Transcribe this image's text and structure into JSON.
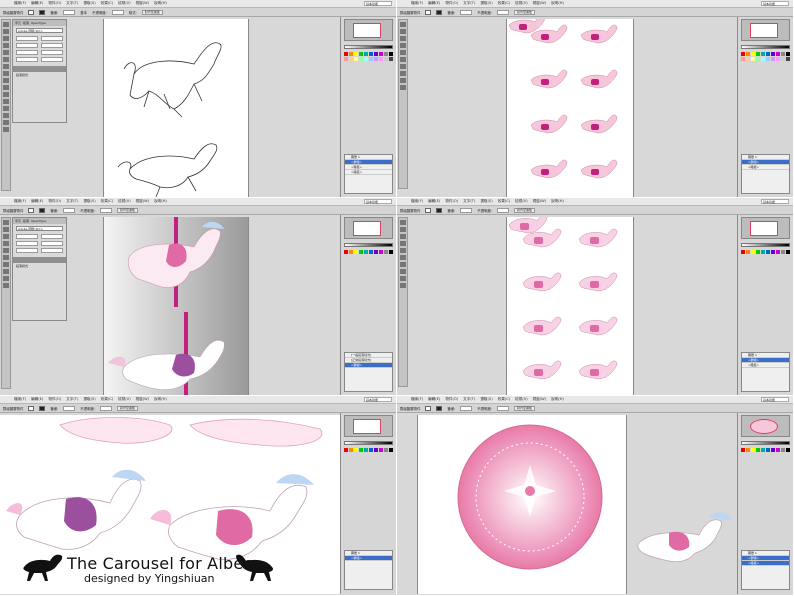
{
  "menu": {
    "items": [
      "檔案(F)",
      "編輯(E)",
      "物件(O)",
      "文字(T)",
      "選取(S)",
      "效果(C)",
      "檢視(V)",
      "視窗(W)",
      "說明(H)"
    ],
    "search_placeholder": "基本功能"
  },
  "control_bar": {
    "group_label": "群組圖層物件",
    "stroke_label": "筆畫:",
    "basic_label": "基本",
    "opacity_label": "不透明度:",
    "style_label": "樣式:",
    "align_label": "對齊至畫板"
  },
  "character_panel": {
    "tabs": [
      "字元",
      "段落",
      "OpenType"
    ],
    "font": "Adobe 明體 Std L",
    "paragraph_caption": "段落樣式",
    "paragraph_rows": [
      "[一般段落樣式]",
      "[正常段落樣式]"
    ]
  },
  "layers_panel": {
    "rows": [
      "圖層 1",
      "<群組>",
      "<路徑>",
      "<路徑>"
    ]
  },
  "colors": {
    "pink": "#e87aa8",
    "magenta": "#c2207c",
    "purple": "#9b4f9e",
    "selection": "#3a6ec8"
  },
  "caption": {
    "title": "The Carousel for Albee",
    "subtitle": "designed by Yingshiuan"
  }
}
